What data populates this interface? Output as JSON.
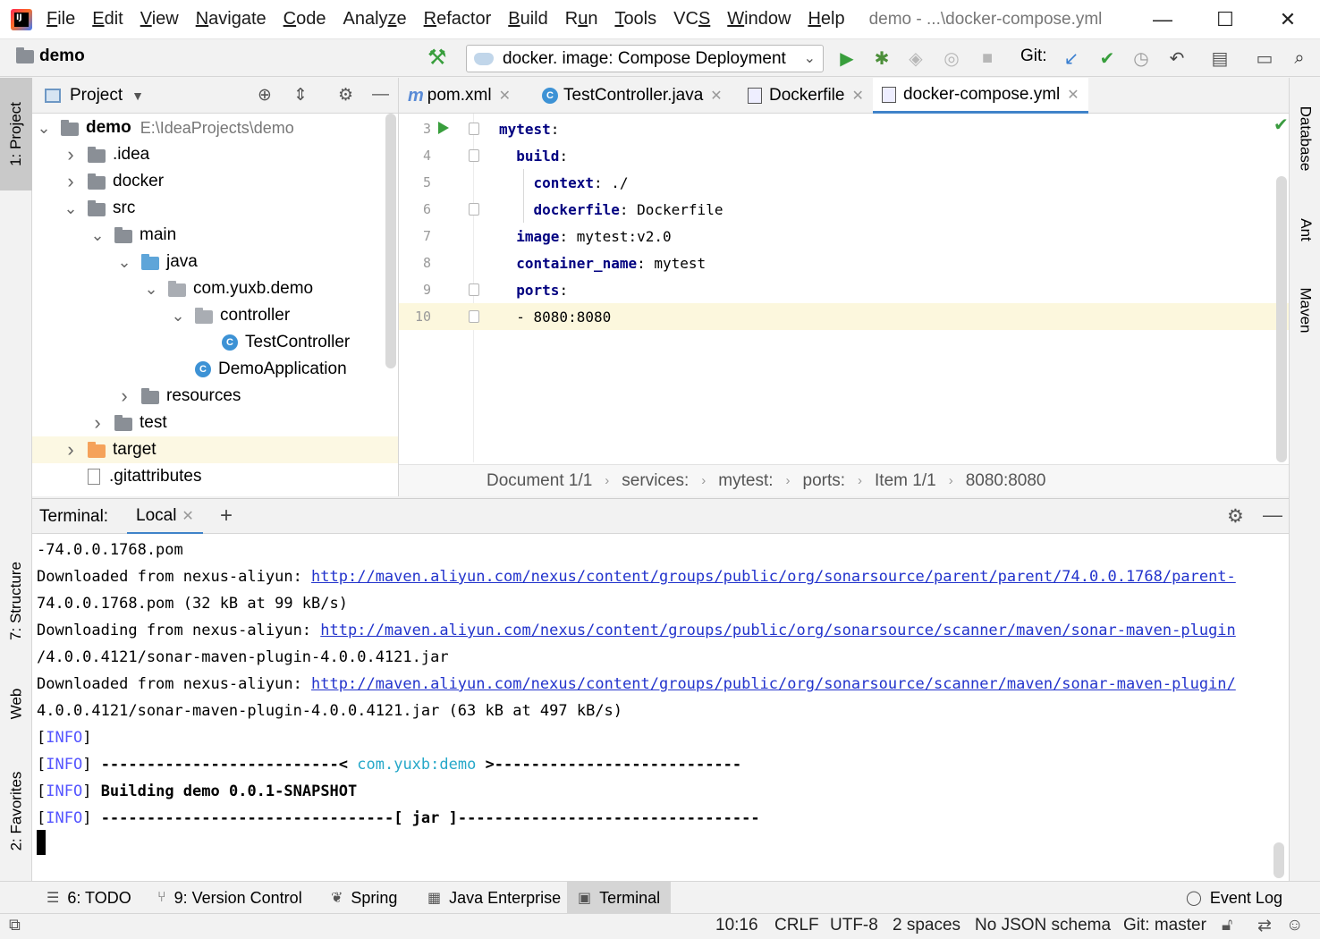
{
  "menu": {
    "items": [
      "File",
      "Edit",
      "View",
      "Navigate",
      "Code",
      "Analyze",
      "Refactor",
      "Build",
      "Run",
      "Tools",
      "VCS",
      "Window",
      "Help"
    ],
    "mnemonics": [
      "F",
      "E",
      "V",
      "N",
      "C",
      "z",
      "R",
      "B",
      "u",
      "T",
      "S",
      "W",
      "H"
    ],
    "window_title": "demo - ...\\docker-compose.yml"
  },
  "window_controls": {
    "minimize": "—",
    "maximize": "☐",
    "close": "✕"
  },
  "navbar": {
    "project_crumb": "demo",
    "run_config": "docker.  image: Compose Deployment",
    "git_label": "Git:"
  },
  "left_strip": {
    "project": "1: Project",
    "structure": "7: Structure",
    "web": "Web",
    "favorites": "2: Favorites"
  },
  "right_strip": {
    "database": "Database",
    "ant": "Ant",
    "maven": "Maven"
  },
  "project_panel": {
    "title": "Project",
    "tree": [
      {
        "label": "demo",
        "path": "E:\\IdeaProjects\\demo",
        "indent": 0,
        "arrow": "down",
        "icon": "folder-gray"
      },
      {
        "label": ".idea",
        "indent": 1,
        "arrow": "right",
        "icon": "folder-gray"
      },
      {
        "label": "docker",
        "indent": 1,
        "arrow": "right",
        "icon": "folder-gray"
      },
      {
        "label": "src",
        "indent": 1,
        "arrow": "down",
        "icon": "folder-gray"
      },
      {
        "label": "main",
        "indent": 2,
        "arrow": "down",
        "icon": "folder-gray"
      },
      {
        "label": "java",
        "indent": 3,
        "arrow": "down",
        "icon": "folder-blue"
      },
      {
        "label": "com.yuxb.demo",
        "indent": 4,
        "arrow": "down",
        "icon": "folder-light"
      },
      {
        "label": "controller",
        "indent": 5,
        "arrow": "down",
        "icon": "folder-light"
      },
      {
        "label": "TestController",
        "indent": 6,
        "arrow": "",
        "icon": "class"
      },
      {
        "label": "DemoApplication",
        "indent": 5,
        "arrow": "",
        "icon": "class"
      },
      {
        "label": "resources",
        "indent": 3,
        "arrow": "right",
        "icon": "folder-gray"
      },
      {
        "label": "test",
        "indent": 2,
        "arrow": "right",
        "icon": "folder-gray"
      },
      {
        "label": "target",
        "indent": 1,
        "arrow": "right",
        "icon": "folder-orange"
      },
      {
        "label": ".gitattributes",
        "indent": 1,
        "arrow": "",
        "icon": "file"
      }
    ]
  },
  "editor": {
    "tabs": [
      {
        "label": "pom.xml",
        "icon": "m"
      },
      {
        "label": "TestController.java",
        "icon": "c"
      },
      {
        "label": "Dockerfile",
        "icon": "doc"
      },
      {
        "label": "docker-compose.yml",
        "icon": "doc",
        "active": true
      }
    ],
    "lines": [
      {
        "n": "3",
        "indent": "",
        "key": "mytest",
        "value": ""
      },
      {
        "n": "4",
        "indent": "  ",
        "key": "build",
        "value": ""
      },
      {
        "n": "5",
        "indent": "    ",
        "key": "context",
        "value": " ./"
      },
      {
        "n": "6",
        "indent": "    ",
        "key": "dockerfile",
        "value": " Dockerfile"
      },
      {
        "n": "7",
        "indent": "  ",
        "key": "image",
        "value": " mytest:v2.0"
      },
      {
        "n": "8",
        "indent": "  ",
        "key": "container_name",
        "value": " mytest"
      },
      {
        "n": "9",
        "indent": "  ",
        "key": "ports",
        "value": ""
      },
      {
        "n": "10",
        "indent": "  ",
        "key": "",
        "value": "- 8080:8080"
      }
    ],
    "breadcrumbs": [
      "Document 1/1",
      "services:",
      "mytest:",
      "ports:",
      "Item 1/1",
      "8080:8080"
    ]
  },
  "terminal": {
    "title": "Terminal:",
    "tab": "Local",
    "lines": [
      {
        "parts": [
          {
            "t": "-74.0.0.1768.pom"
          }
        ]
      },
      {
        "parts": [
          {
            "t": "Downloaded from nexus-aliyun: "
          },
          {
            "t": "http://maven.aliyun.com/nexus/content/groups/public/org/sonarsource/parent/parent/74.0.0.1768/parent-",
            "link": true
          }
        ]
      },
      {
        "parts": [
          {
            "t": "74.0.0.1768.pom (32 kB at 99 kB/s)"
          }
        ]
      },
      {
        "parts": [
          {
            "t": "Downloading from nexus-aliyun: "
          },
          {
            "t": "http://maven.aliyun.com/nexus/content/groups/public/org/sonarsource/scanner/maven/sonar-maven-plugin",
            "link": true
          }
        ]
      },
      {
        "parts": [
          {
            "t": "/4.0.0.4121/sonar-maven-plugin-4.0.0.4121.jar"
          }
        ]
      },
      {
        "parts": [
          {
            "t": "Downloaded from nexus-aliyun: "
          },
          {
            "t": "http://maven.aliyun.com/nexus/content/groups/public/org/sonarsource/scanner/maven/sonar-maven-plugin/",
            "link": true
          }
        ]
      },
      {
        "parts": [
          {
            "t": "4.0.0.4121/sonar-maven-plugin-4.0.0.4121.jar (63 kB at 497 kB/s)"
          }
        ]
      },
      {
        "parts": [
          {
            "t": "["
          },
          {
            "t": "INFO",
            "info": true
          },
          {
            "t": "]"
          }
        ]
      },
      {
        "parts": [
          {
            "t": "["
          },
          {
            "t": "INFO",
            "info": true
          },
          {
            "t": "] "
          },
          {
            "t": "--------------------------< ",
            "bold": true
          },
          {
            "t": "com.yuxb:demo",
            "cyan": true
          },
          {
            "t": " >---------------------------",
            "bold": true
          }
        ]
      },
      {
        "parts": [
          {
            "t": "["
          },
          {
            "t": "INFO",
            "info": true
          },
          {
            "t": "] "
          },
          {
            "t": "Building demo 0.0.1-SNAPSHOT",
            "bold": true
          }
        ]
      },
      {
        "parts": [
          {
            "t": "["
          },
          {
            "t": "INFO",
            "info": true
          },
          {
            "t": "] "
          },
          {
            "t": "--------------------------------[ jar ]---------------------------------",
            "bold": true
          }
        ]
      }
    ]
  },
  "bottom_tabs": [
    {
      "label": "6: TODO",
      "icon": "☰"
    },
    {
      "label": "9: Version Control",
      "icon": "⑂"
    },
    {
      "label": "Spring",
      "icon": "❦"
    },
    {
      "label": "Java Enterprise",
      "icon": "▦"
    },
    {
      "label": "Terminal",
      "icon": "▣",
      "active": true
    }
  ],
  "event_log": "Event Log",
  "status": {
    "position": "10:16",
    "line_sep": "CRLF",
    "encoding": "UTF-8",
    "indent": "2 spaces",
    "schema": "No JSON schema",
    "git_branch": "Git: master"
  }
}
